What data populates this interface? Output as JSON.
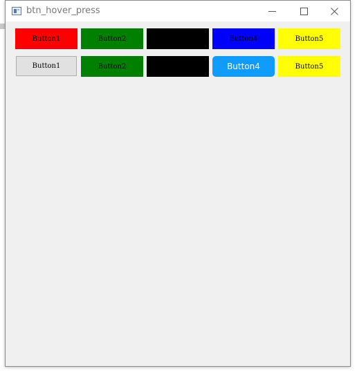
{
  "window": {
    "title": "btn_hover_press",
    "icon": "app-window-icon",
    "controls": {
      "minimize_icon": "minimize-icon",
      "maximize_icon": "maximize-icon",
      "close_icon": "close-icon"
    }
  },
  "rows": [
    {
      "buttons": [
        {
          "label": "Button1",
          "color": "#ff0000"
        },
        {
          "label": "Button2",
          "color": "#008000"
        },
        {
          "label": "",
          "color": "#000000"
        },
        {
          "label": "Button4",
          "color": "#0000ff"
        },
        {
          "label": "Button5",
          "color": "#ffff00"
        }
      ]
    },
    {
      "buttons": [
        {
          "label": "Button1",
          "color": "#e1e1e1"
        },
        {
          "label": "Button2",
          "color": "#008000"
        },
        {
          "label": "",
          "color": "#000000"
        },
        {
          "label": "Button4",
          "color": "#0f9bff",
          "state": "hover"
        },
        {
          "label": "Button5",
          "color": "#ffff00"
        }
      ]
    }
  ]
}
